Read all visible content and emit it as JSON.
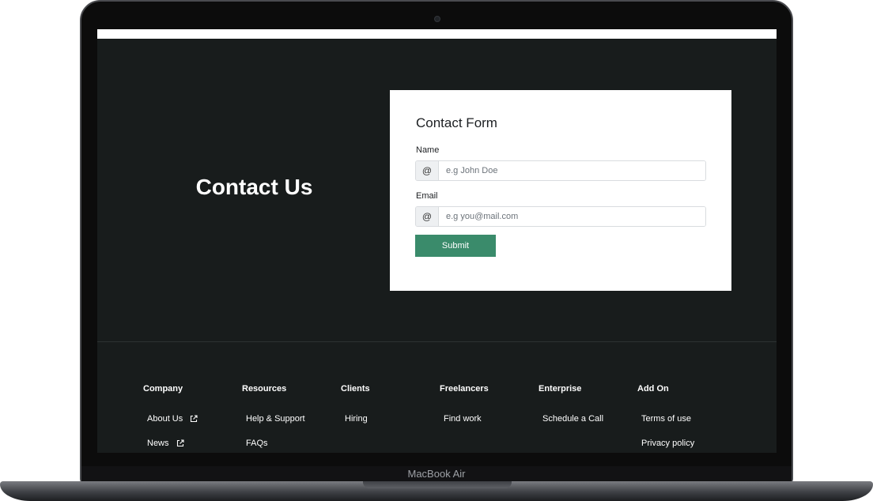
{
  "device": {
    "model_label": "MacBook Air"
  },
  "hero": {
    "title": "Contact Us"
  },
  "form": {
    "title": "Contact Form",
    "name": {
      "label": "Name",
      "addon": "@",
      "placeholder": "e.g John Doe",
      "value": ""
    },
    "email": {
      "label": "Email",
      "addon": "@",
      "placeholder": "e.g you@mail.com",
      "value": ""
    },
    "submit_label": "Submit",
    "colors": {
      "submit": "#3a8b6b",
      "background": "#181c1c"
    }
  },
  "footer": {
    "columns": [
      {
        "heading": "Company",
        "links": [
          {
            "label": "About Us",
            "icon": "external-link-icon"
          },
          {
            "label": "News",
            "icon": "external-link-icon"
          }
        ]
      },
      {
        "heading": "Resources",
        "links": [
          {
            "label": "Help & Support"
          },
          {
            "label": "FAQs"
          }
        ]
      },
      {
        "heading": "Clients",
        "links": [
          {
            "label": "Hiring"
          }
        ]
      },
      {
        "heading": "Freelancers",
        "links": [
          {
            "label": "Find work"
          }
        ]
      },
      {
        "heading": "Enterprise",
        "links": [
          {
            "label": "Schedule a Call"
          }
        ]
      },
      {
        "heading": "Add On",
        "links": [
          {
            "label": "Terms of use"
          },
          {
            "label": "Privacy policy"
          }
        ]
      }
    ]
  }
}
